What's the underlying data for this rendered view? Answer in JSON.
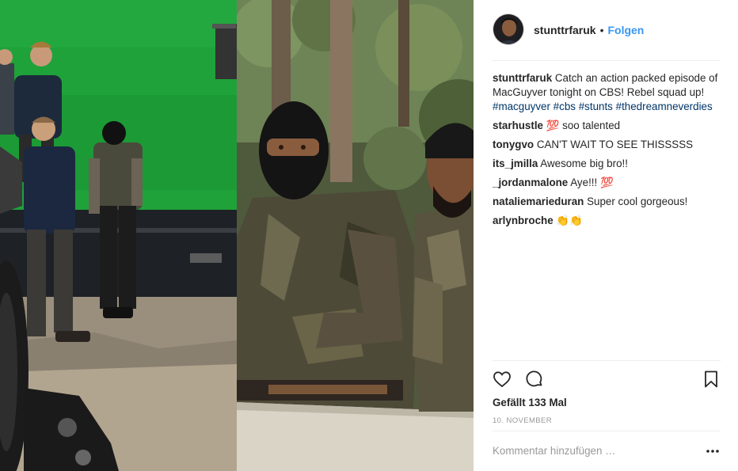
{
  "post": {
    "username": "stunttrfaruk",
    "separator": "•",
    "follow_label": "Folgen",
    "caption": {
      "username": "stunttrfaruk",
      "text": "Catch an action packed episode of MacGuyver tonight on CBS! Rebel squad up!",
      "hashtags": [
        "#macguyver",
        "#cbs",
        "#stunts",
        "#thedreamneverdies"
      ]
    },
    "comments": [
      {
        "user": "starhustle",
        "text": "💯 soo talented"
      },
      {
        "user": "tonygvo",
        "text": "CAN'T WAIT TO SEE THISSSSS"
      },
      {
        "user": "its_jmilla",
        "text": "Awesome big bro!!"
      },
      {
        "user": "_jordanmalone",
        "text": "Aye!!! 💯"
      },
      {
        "user": "nataliemarieduran",
        "text": "Super cool gorgeous!"
      },
      {
        "user": "arlynbroche",
        "text": "👏👏"
      }
    ],
    "likes": "Gefällt 133 Mal",
    "date": "10. NOVEMBER",
    "add_comment_placeholder": "Kommentar hinzufügen …",
    "icons": {
      "like": "heart-icon",
      "comment": "comment-icon",
      "save": "bookmark-icon",
      "more": "more-options-icon"
    }
  },
  "colors": {
    "link": "#3897f0",
    "hashtag": "#003569",
    "green_screen": "#1fa23a"
  }
}
